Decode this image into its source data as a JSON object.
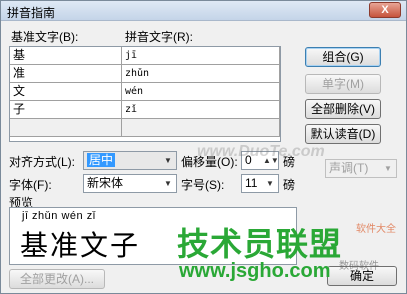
{
  "window": {
    "title": "拼音指南",
    "close_label": "X"
  },
  "grid": {
    "base_header": "基准文字(B):",
    "pinyin_header": "拼音文字(R):",
    "rows": [
      {
        "base": "基",
        "pinyin": "jī"
      },
      {
        "base": "准",
        "pinyin": "zhǔn"
      },
      {
        "base": "文",
        "pinyin": "wén"
      },
      {
        "base": "子",
        "pinyin": "zǐ"
      },
      {
        "base": "",
        "pinyin": ""
      }
    ]
  },
  "buttons": {
    "combine": "组合(G)",
    "single": "单字(M)",
    "delete_all": "全部删除(V)",
    "default_reading": "默认读音(D)",
    "tone": "声调(T)",
    "change_all": "全部更改(A)...",
    "ok": "确定"
  },
  "options": {
    "align_label": "对齐方式(L):",
    "align_value": "居中",
    "offset_label": "偏移量(O):",
    "offset_value": "0",
    "offset_unit": "磅",
    "font_label": "字体(F):",
    "font_value": "新宋体",
    "size_label": "字号(S):",
    "size_value": "11",
    "size_unit": "磅"
  },
  "preview": {
    "label": "预览",
    "ruby": "jī zhǔn wén  zǐ",
    "text": "基准文子"
  },
  "watermarks": {
    "duote": "www.DuoTe.com",
    "logo": "技术员联盟",
    "url": "www.jsgho.com",
    "corner_top": "软件大全",
    "corner_bottom": "数码软件"
  }
}
